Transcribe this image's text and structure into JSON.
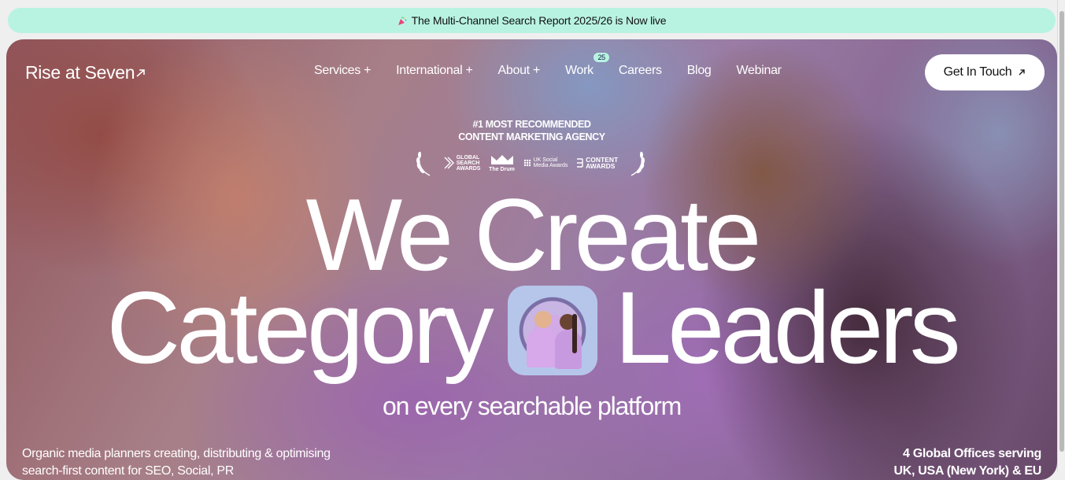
{
  "announcement": {
    "icon": "party-popper-icon",
    "text": "The Multi-Channel Search Report 2025/26 is Now live"
  },
  "header": {
    "logo_text": "Rise at Seven",
    "nav": [
      {
        "label": "Services +"
      },
      {
        "label": "International +"
      },
      {
        "label": "About +"
      },
      {
        "label": "Work",
        "badge": "25"
      },
      {
        "label": "Careers"
      },
      {
        "label": "Blog"
      },
      {
        "label": "Webinar"
      }
    ],
    "cta_label": "Get In Touch",
    "cta_icon": "arrow-up-right-icon"
  },
  "hero": {
    "award_line_1": "#1 MOST RECOMMENDED",
    "award_line_2": "CONTENT MARKETING AGENCY",
    "awards": [
      {
        "name": "GLOBAL SEARCH AWARDS",
        "lines": [
          "GLOBAL",
          "SEARCH",
          "AWARDS"
        ]
      },
      {
        "name": "The Drum",
        "lines": [
          "The Drum"
        ]
      },
      {
        "name": "UK Social Media Awards",
        "lines": [
          "UK Social",
          "Media Awards"
        ]
      },
      {
        "name": "CONTENT AWARDS",
        "lines": [
          "CONTENT",
          "AWARDS"
        ]
      }
    ],
    "headline_line1": "We Create",
    "headline_word_left": "Category",
    "headline_word_right": "Leaders",
    "subheadline": "on every searchable platform",
    "description_left": "Organic media planners creating, distributing & optimising search-first content for SEO, Social, PR",
    "description_right_line1": "4 Global Offices serving",
    "description_right_line2": "UK, USA (New York) & EU"
  },
  "colors": {
    "announcement_bg": "#b8f3e2",
    "cta_bg": "#ffffff",
    "text_light": "#ffffff"
  }
}
